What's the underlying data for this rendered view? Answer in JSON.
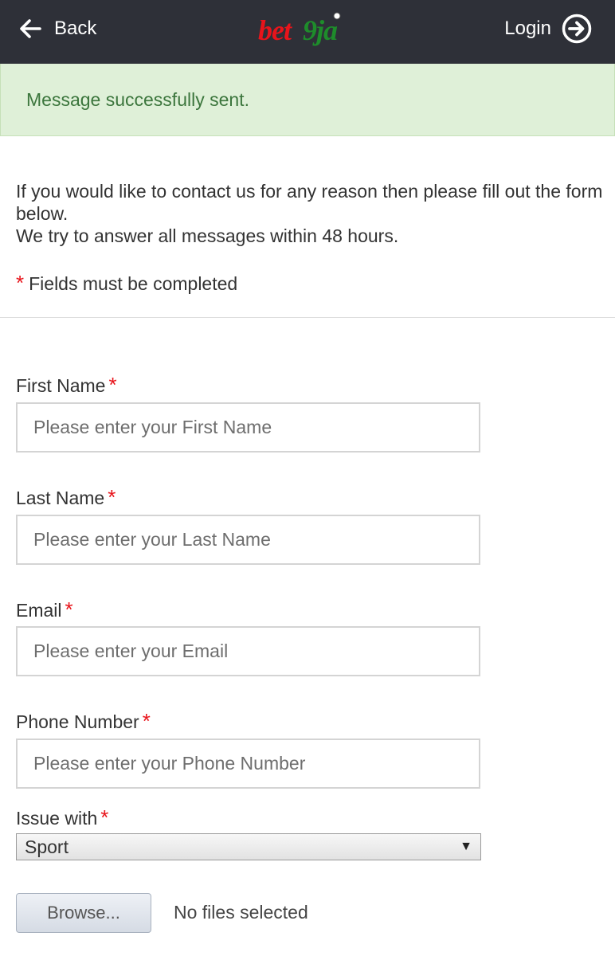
{
  "header": {
    "back_label": "Back",
    "logo_text": "bet9ja",
    "login_label": "Login"
  },
  "alert": {
    "message": "Message successfully sent."
  },
  "intro": {
    "line1": "If you would like to contact us for any reason then please fill out the form below.",
    "line2": "We try to answer all messages within 48 hours."
  },
  "required_note": {
    "star": "*",
    "text": "Fields must be completed"
  },
  "form": {
    "first_name": {
      "label": "First Name",
      "placeholder": "Please enter your First Name",
      "value": ""
    },
    "last_name": {
      "label": "Last Name",
      "placeholder": "Please enter your Last Name",
      "value": ""
    },
    "email": {
      "label": "Email",
      "placeholder": "Please enter your Email",
      "value": ""
    },
    "phone": {
      "label": "Phone Number",
      "placeholder": "Please enter your Phone Number",
      "value": ""
    },
    "issue": {
      "label": "Issue with",
      "selected": "Sport"
    },
    "required_marker": "*",
    "file": {
      "browse_label": "Browse...",
      "status": "No files selected"
    }
  },
  "colors": {
    "header_bg": "#2e3038",
    "alert_bg": "#dff0d8",
    "alert_text": "#3c763d",
    "required_star": "#e8141b",
    "logo_red": "#e8141b",
    "logo_green": "#1e8c2b"
  }
}
